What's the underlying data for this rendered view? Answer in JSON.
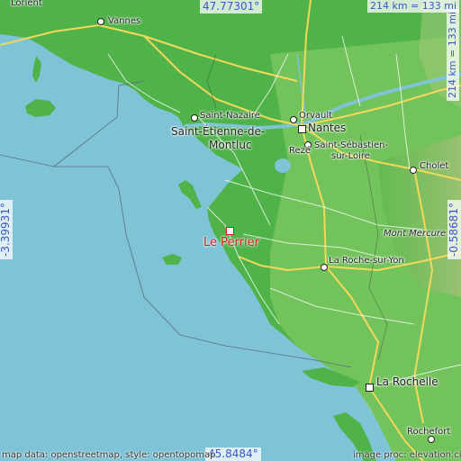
{
  "map": {
    "latitude_top": "47.77301°",
    "latitude_bottom": "45.8484°",
    "longitude_left": "-3.39931°",
    "longitude_right": "-0.58681°",
    "scale_top": "214 km = 133 mi",
    "scale_right": "214 km = 133 mi",
    "credit_left": "map data: openstreetmap, style: opentopomap",
    "credit_right": "image proc: elevation.city",
    "marker": {
      "label": "Le Perrier",
      "color": "#d02020"
    },
    "colors": {
      "sea": "#7ec3d6",
      "land": "#4fb34a",
      "land_light": "#8fcf6a",
      "hills": "#b8a07a",
      "road_major": "#f3d85a"
    },
    "places": {
      "lorient": "Lorient",
      "vannes": "Vannes",
      "saint_nazaire": "Saint-Nazaire",
      "saint_etienne_1": "Saint-Étienne-de-",
      "saint_etienne_2": "Montluc",
      "orvault": "Orvault",
      "nantes": "Nantes",
      "reze": "Rezé",
      "saint_sebastien_1": "Saint-Sébastien-",
      "saint_sebastien_2": "sur-Loire",
      "cholet": "Cholet",
      "mont_mercure": "Mont Mercure",
      "la_roche": "La Roche-sur-Yon",
      "la_rochelle": "La Rochelle",
      "rochefort": "Rochefort"
    }
  }
}
